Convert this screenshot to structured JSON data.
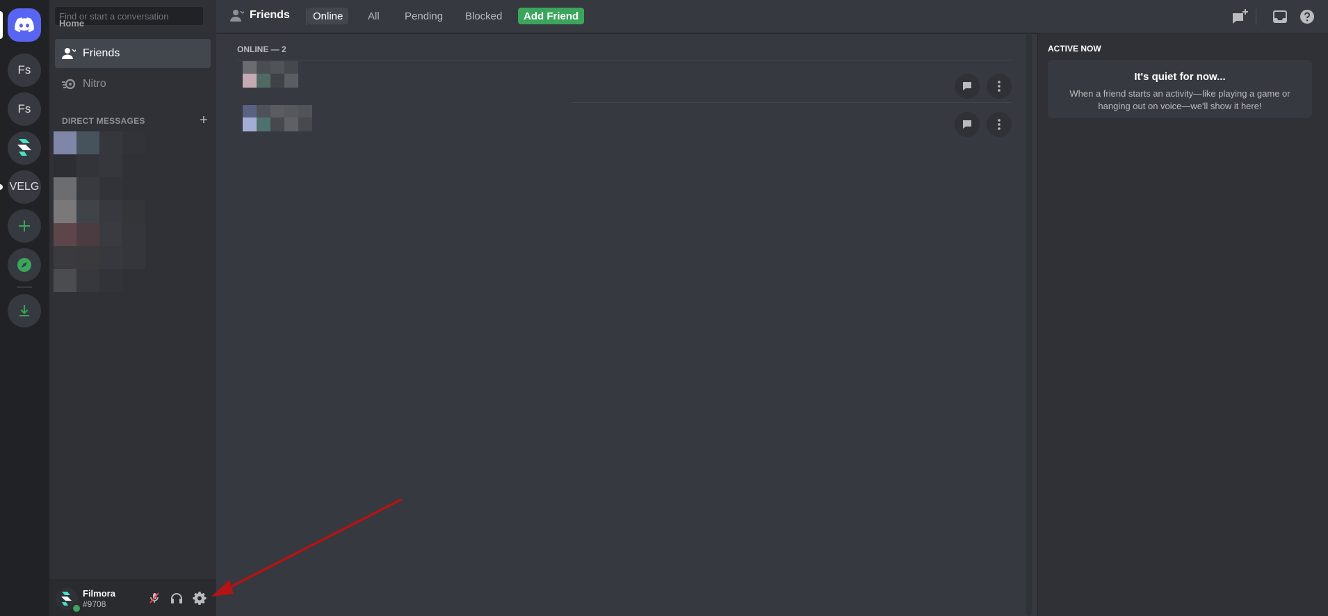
{
  "rail": {
    "home_tooltip": "Home",
    "servers": [
      {
        "label": "Fs"
      },
      {
        "label": "Fs"
      },
      {
        "label": ""
      },
      {
        "label": "VELG"
      }
    ]
  },
  "sidebar": {
    "search_placeholder": "Find or start a conversation",
    "nav": [
      {
        "label": "Friends",
        "icon": "friends-icon"
      },
      {
        "label": "Nitro",
        "icon": "nitro-icon"
      }
    ],
    "direct_messages_header": "DIRECT MESSAGES",
    "add_dm": "+"
  },
  "user": {
    "name": "Filmora",
    "tag": "#9708",
    "status_color": "#3ba55d"
  },
  "topbar": {
    "title": "Friends",
    "tabs": [
      {
        "label": "Online",
        "active": true
      },
      {
        "label": "All"
      },
      {
        "label": "Pending"
      },
      {
        "label": "Blocked"
      },
      {
        "label": "Add Friend",
        "style": "green"
      }
    ]
  },
  "friends": {
    "header": "ONLINE — 2"
  },
  "active_now": {
    "title": "ACTIVE NOW",
    "card_title": "It's quiet for now...",
    "card_body": "When a friend starts an activity—like playing a game or hanging out on voice—we'll show it here!"
  },
  "colors": {
    "accent": "#5865f2",
    "green": "#3ba55d",
    "annotation_arrow": "#b31414"
  }
}
